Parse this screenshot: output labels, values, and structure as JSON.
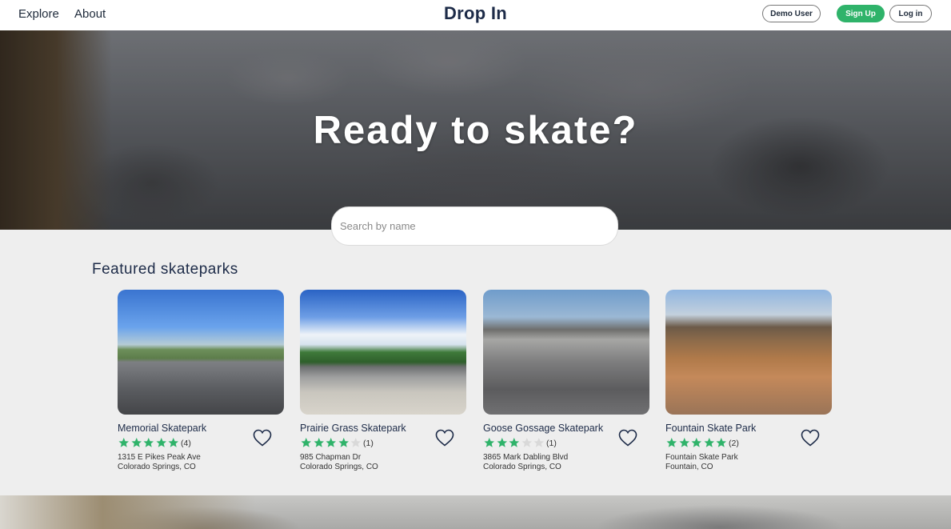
{
  "nav": {
    "explore": "Explore",
    "about": "About",
    "brand": "Drop In",
    "demo_user": "Demo User",
    "sign_up": "Sign Up",
    "log_in": "Log in"
  },
  "hero": {
    "title": "Ready to skate?"
  },
  "search": {
    "placeholder": "Search by name",
    "value": ""
  },
  "featured": {
    "title": "Featured skateparks",
    "parks": [
      {
        "name": "Memorial Skatepark",
        "rating": 5,
        "count": "(4)",
        "address_line1": "1315 E Pikes Peak Ave",
        "address_line2": "Colorado Springs, CO"
      },
      {
        "name": "Prairie Grass Skatepark",
        "rating": 4,
        "count": "(1)",
        "address_line1": "985 Chapman Dr",
        "address_line2": "Colorado Springs, CO"
      },
      {
        "name": "Goose Gossage Skatepark",
        "rating": 3,
        "count": "(1)",
        "address_line1": "3865 Mark Dabling Blvd",
        "address_line2": "Colorado Springs, CO"
      },
      {
        "name": "Fountain Skate Park",
        "rating": 5,
        "count": "(2)",
        "address_line1": "Fountain Skate Park",
        "address_line2": "Fountain, CO"
      }
    ]
  },
  "colors": {
    "brand_navy": "#1d2b48",
    "sign_up_green": "#2fb36a",
    "star_filled": "#2fb36a",
    "star_empty": "#d9d9d9"
  },
  "icons": {
    "favorite": "heart-outline-icon",
    "rating": "star-icon"
  }
}
